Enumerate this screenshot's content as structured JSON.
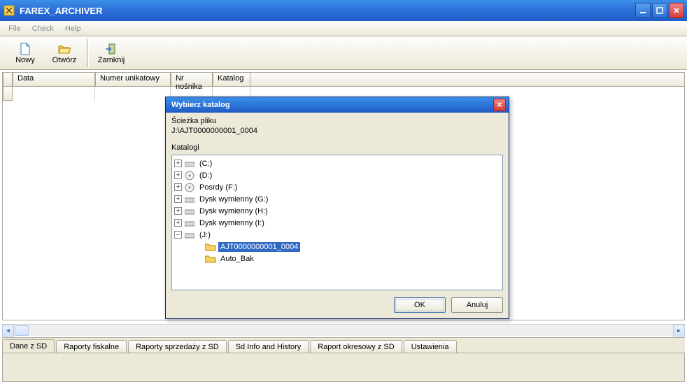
{
  "window": {
    "title": "FAREX_ARCHIVER"
  },
  "menu": {
    "file": "File",
    "check": "Check",
    "help": "Help"
  },
  "toolbar": {
    "new": "Nowy",
    "open": "Otwórz",
    "close": "Zamknij"
  },
  "table": {
    "col_date": "Data",
    "col_unique": "Numer unikatowy",
    "col_media": "Nr nośnika",
    "col_catalog": "Katalog"
  },
  "tabs": {
    "t1": "Dane z SD",
    "t2": "Raporty fiskalne",
    "t3": "Raporty sprzedaży z SD",
    "t4": "Sd Info and History",
    "t5": "Raport okresowy z SD",
    "t6": "Ustawienia"
  },
  "dialog": {
    "title": "Wybierz katalog",
    "path_label": "Ścieżka pliku",
    "path_value": "J:\\AJT0000000001_0004",
    "cat_label": "Katalogi",
    "nodes": {
      "c": "(C:)",
      "d": "(D:)",
      "f": "Posrdy (F:)",
      "g": "Dysk wymienny (G:)",
      "h": "Dysk wymienny (H:)",
      "i": "Dysk wymienny (I:)",
      "j": "(J:)",
      "sel": "AJT0000000001_0004",
      "auto": "Auto_Bak"
    },
    "ok": "OK",
    "cancel": "Anuluj"
  }
}
